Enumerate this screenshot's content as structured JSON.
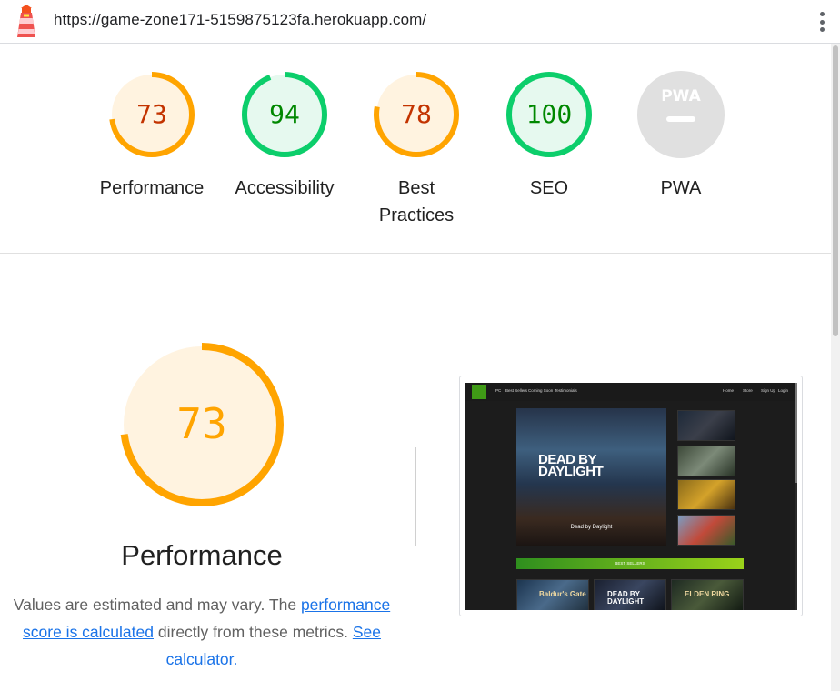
{
  "address_bar": {
    "url": "https://game-zone171-5159875123fa.herokuapp.com/"
  },
  "icons": {
    "app_logo": "lighthouse-icon",
    "menu": "kebab-menu-icon"
  },
  "colors": {
    "average": "#ffa400",
    "average_bg": "#fff3e0",
    "average_text": "#c33300",
    "pass": "#0cce6b",
    "pass_bg": "#e6f9ef",
    "pass_text": "#008800",
    "na": "#e0e0e0",
    "link": "#1a73e8"
  },
  "gauges": [
    {
      "label_line1": "Performance",
      "label_line2": "",
      "score": "73",
      "fraction": 0.73,
      "status": "average"
    },
    {
      "label_line1": "Accessibility",
      "label_line2": "",
      "score": "94",
      "fraction": 0.94,
      "status": "pass"
    },
    {
      "label_line1": "Best",
      "label_line2": "Practices",
      "score": "78",
      "fraction": 0.78,
      "status": "average"
    },
    {
      "label_line1": "SEO",
      "label_line2": "",
      "score": "100",
      "fraction": 1.0,
      "status": "pass"
    },
    {
      "label_line1": "PWA",
      "label_line2": "",
      "badge": "PWA",
      "status": "not-applicable"
    }
  ],
  "performance": {
    "score": "73",
    "fraction": 0.73,
    "title": "Performance",
    "description_before": "Values are estimated and may vary. The",
    "link_text": "performance score is calculated",
    "description_middle": "directly from these metrics.",
    "calculator_link": "See calculator."
  },
  "screenshot": {
    "nav": [
      "PC",
      "Best Sellers",
      "Coming Soon",
      "Testimonials"
    ],
    "nav_right": [
      "Home",
      "Store",
      "Sign Up",
      "Login"
    ],
    "hero_title_line1": "DEAD BY",
    "hero_title_line2": "DAYLIGHT",
    "hero_caption": "Dead by Daylight",
    "best_sellers_button": "BEST SELLERS",
    "bottom_titles": [
      "Baldur's Gate",
      "DEAD BY DAYLIGHT",
      "ELDEN RING"
    ]
  }
}
